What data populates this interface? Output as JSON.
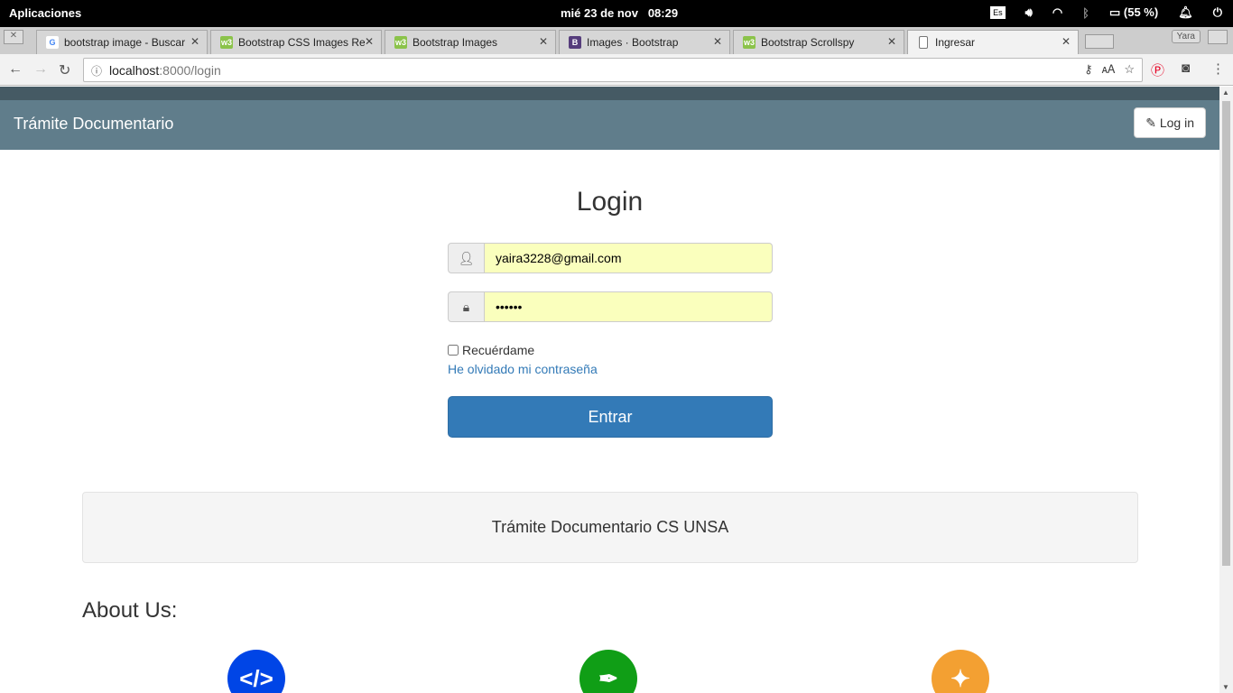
{
  "system": {
    "apps": "Aplicaciones",
    "clock": "mié 23 de nov   08:29",
    "lang": "Es",
    "battery": "(55 %)"
  },
  "browser": {
    "tabs": [
      {
        "label": "bootstrap image - Buscar",
        "favicon": "G",
        "color": "#4285f4"
      },
      {
        "label": "Bootstrap CSS Images Re",
        "favicon": "w3",
        "color": "#8bc34a"
      },
      {
        "label": "Bootstrap Images",
        "favicon": "w3",
        "color": "#8bc34a"
      },
      {
        "label": "Images · Bootstrap",
        "favicon": "B",
        "color": "#563d7c"
      },
      {
        "label": "Bootstrap Scrollspy",
        "favicon": "w3",
        "color": "#8bc34a"
      },
      {
        "label": "Ingresar",
        "favicon": "doc",
        "color": "#ffffff"
      }
    ],
    "profile": "Yara",
    "url_host": "localhost",
    "url_rest": ":8000/login"
  },
  "navbar": {
    "brand": "Trámite Documentario",
    "login": "Log in"
  },
  "form": {
    "title": "Login",
    "email": "yaira3228@gmail.com",
    "password": "••••••",
    "remember": "Recuérdame",
    "forgot": "He olvidado mi contraseña",
    "submit": "Entrar"
  },
  "footer_well": "Trámite Documentario CS UNSA",
  "about": {
    "title": "About Us:",
    "icons": [
      {
        "name": "code",
        "color": "#0045e6"
      },
      {
        "name": "pen",
        "color": "#109e16"
      },
      {
        "name": "magic",
        "color": "#f3a032"
      }
    ]
  }
}
